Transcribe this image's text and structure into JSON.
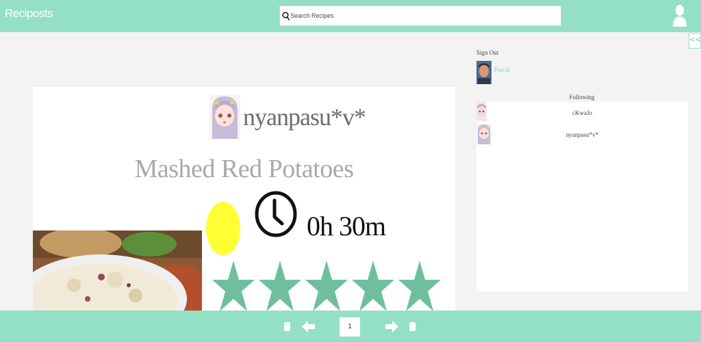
{
  "header": {
    "brand": "Reciposts",
    "search_placeholder": "Search Recipes",
    "user_icon": "user-icon"
  },
  "sidebar_toggle": {
    "label": "<<"
  },
  "recipe": {
    "author": "nyanpasu*v*",
    "title": "Mashed Red Potatoes",
    "time": "0h 30m",
    "rating": 5,
    "rating_max": 5,
    "difficulty_color": "#ffff33",
    "star_color": "#6fbf9f"
  },
  "account": {
    "sign_out": "Sign Out",
    "username": "Pascal"
  },
  "following": {
    "label": "Following",
    "users": [
      {
        "name": "cKwaJo"
      },
      {
        "name": "nyanpasu*v*"
      }
    ]
  },
  "pagination": {
    "current_page": "1"
  },
  "colors": {
    "accent": "#94e0c6",
    "background": "#f3f3f3"
  }
}
